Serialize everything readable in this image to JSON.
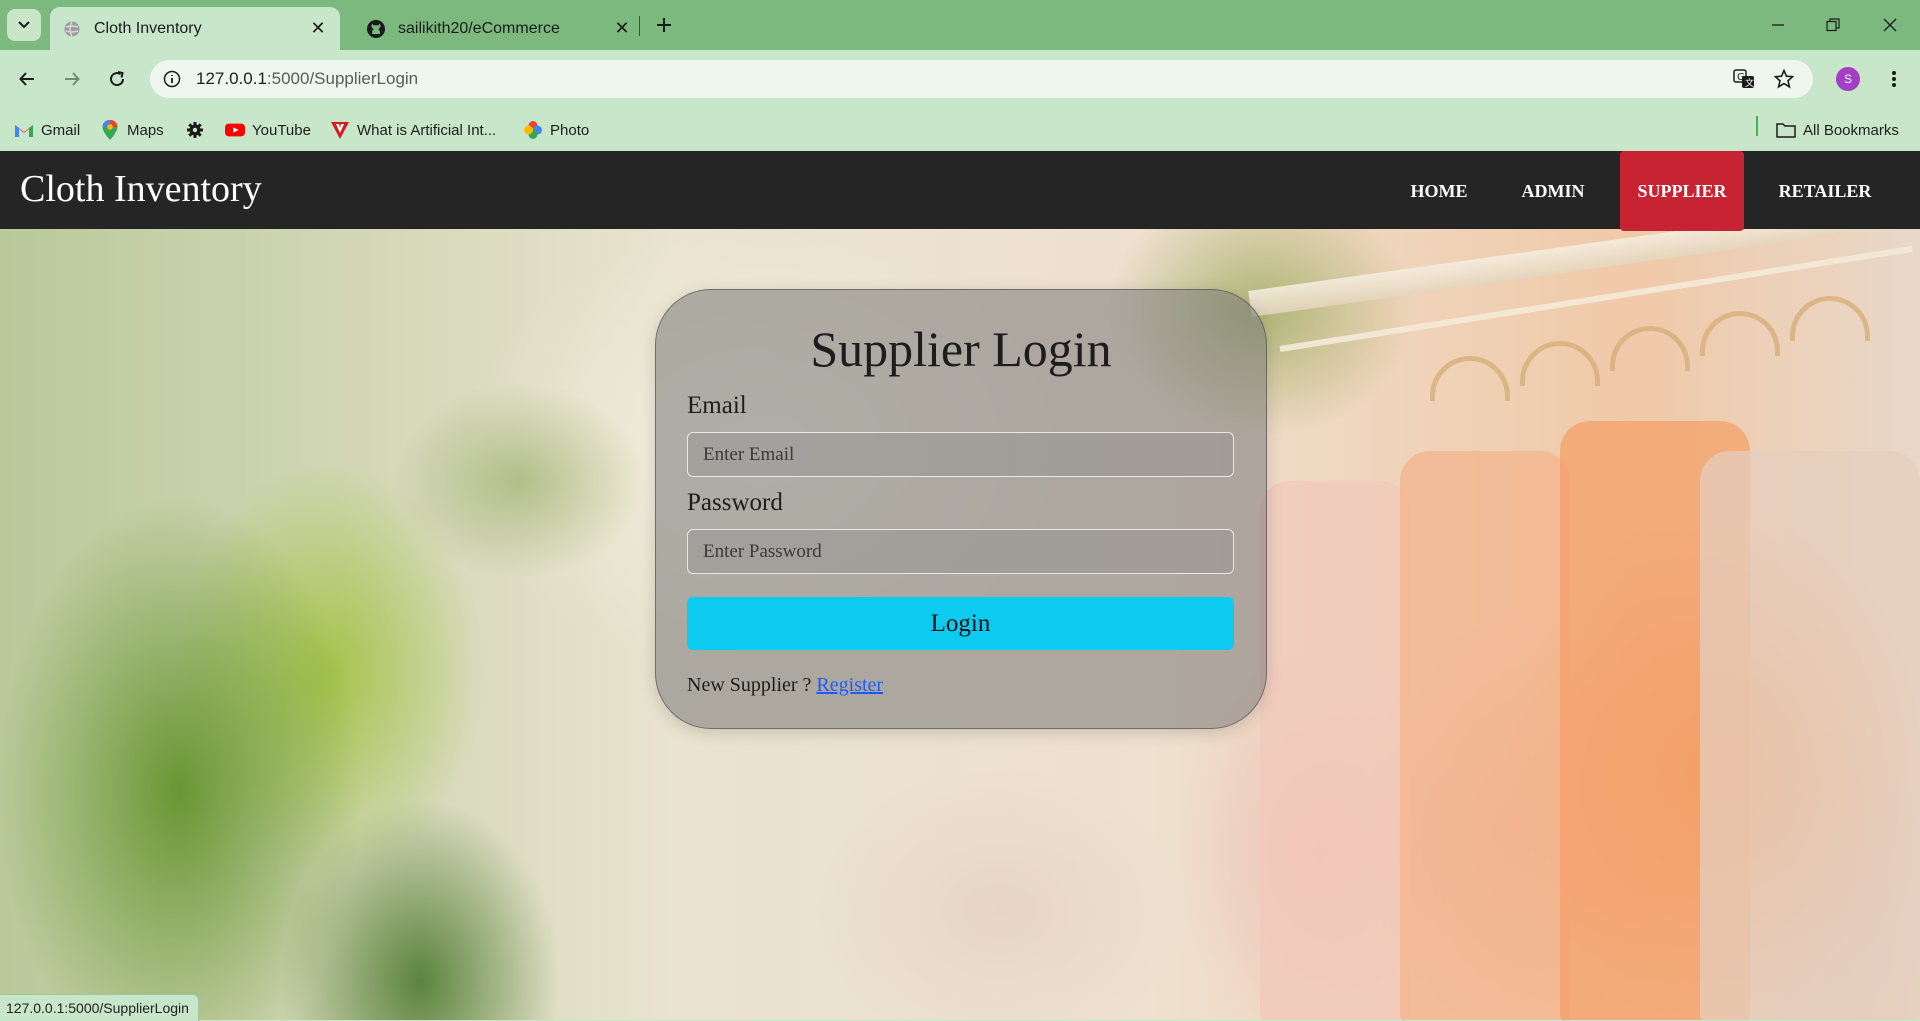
{
  "browser": {
    "tabs": [
      {
        "title": "Cloth Inventory",
        "favicon": "globe-icon",
        "active": true
      },
      {
        "title": "sailikith20/eCommerce",
        "favicon": "github-icon",
        "active": false
      }
    ],
    "url_host": "127.0.0.1",
    "url_path": ":5000/SupplierLogin",
    "profile_initial": "S",
    "bookmarks": [
      {
        "label": "Gmail",
        "icon": "gmail-icon"
      },
      {
        "label": "Maps",
        "icon": "maps-icon"
      },
      {
        "label": "",
        "icon": "gear-icon"
      },
      {
        "label": "YouTube",
        "icon": "youtube-icon"
      },
      {
        "label": "What is Artificial Int...",
        "icon": "v-logo-icon"
      },
      {
        "label": "Photo",
        "icon": "photos-icon"
      }
    ],
    "all_bookmarks": "All Bookmarks",
    "status_url": "127.0.0.1:5000/SupplierLogin"
  },
  "navbar": {
    "brand": "Cloth Inventory",
    "items": [
      {
        "label": "HOME",
        "active": false
      },
      {
        "label": "ADMIN",
        "active": false
      },
      {
        "label": "SUPPLIER",
        "active": true
      },
      {
        "label": "RETAILER",
        "active": false
      }
    ]
  },
  "login": {
    "title": "Supplier Login",
    "email_label": "Email",
    "email_placeholder": "Enter Email",
    "email_value": "",
    "password_label": "Password",
    "password_placeholder": "Enter Password",
    "password_value": "",
    "button": "Login",
    "register_prompt": "New Supplier ?",
    "register_link": "Register"
  },
  "colors": {
    "navbar_bg": "#252525",
    "active_nav": "#c82333",
    "login_button": "#0dcaf0",
    "link": "#1a5cff",
    "browser_frame": "#7cb97e"
  }
}
